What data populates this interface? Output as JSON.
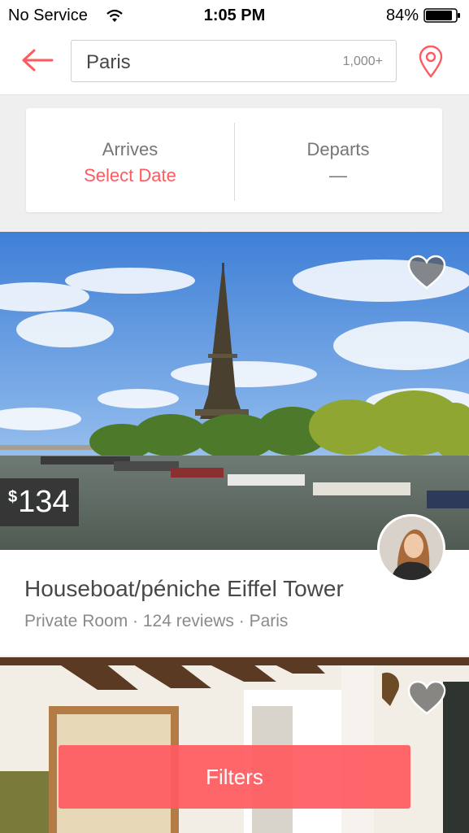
{
  "status_bar": {
    "carrier": "No Service",
    "time": "1:05 PM",
    "battery": "84%"
  },
  "search": {
    "value": "Paris",
    "count": "1,000+"
  },
  "dates": {
    "arrives_label": "Arrives",
    "arrives_value": "Select Date",
    "departs_label": "Departs",
    "departs_value": "—"
  },
  "listings": [
    {
      "currency": "$",
      "price": "134",
      "title": "Houseboat/péniche Eiffel Tower",
      "meta": "Private Room · 124 reviews · Paris"
    }
  ],
  "filters": {
    "label": "Filters"
  },
  "colors": {
    "accent": "#ff5a5f",
    "text": "#484848",
    "muted": "#8a8a8a"
  }
}
